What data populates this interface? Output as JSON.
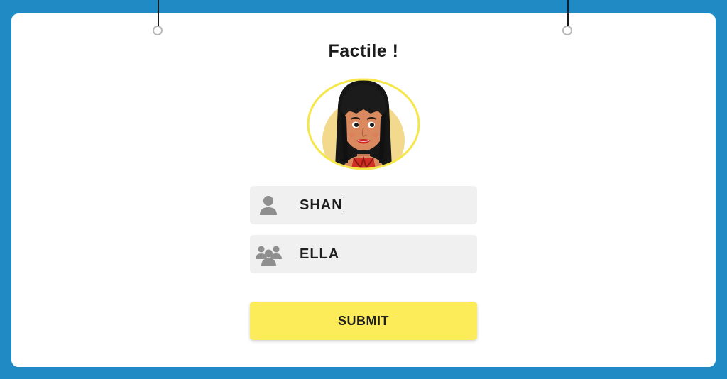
{
  "app": {
    "title": "Factile !"
  },
  "form": {
    "name_field": {
      "value": "SHAN",
      "icon": "person-icon"
    },
    "team_field": {
      "value": "ELLA",
      "icon": "group-icon"
    },
    "submit_label": "SUBMIT"
  },
  "colors": {
    "background": "#1f8ac3",
    "card": "#ffffff",
    "field": "#f0f0f0",
    "submit": "#fcec59",
    "avatar_ring": "#f5e64a"
  }
}
